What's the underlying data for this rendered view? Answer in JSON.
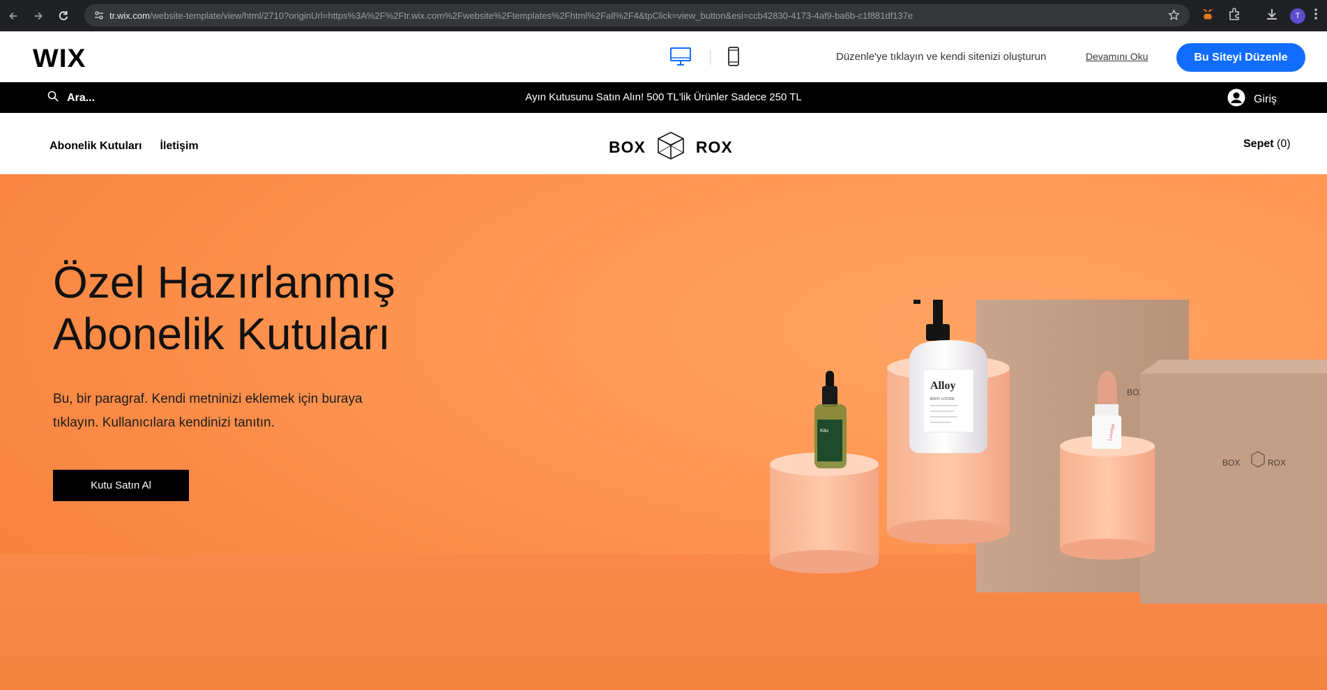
{
  "browser": {
    "url_host": "tr.wix.com",
    "url_rest": "/website-template/view/html/2710?originUrl=https%3A%2F%2Ftr.wix.com%2Fwebsite%2Ftemplates%2Fhtml%2Fall%2F4&tpClick=view_button&esi=ccb42830-4173-4af9-ba6b-c1f881df137e",
    "profile_initial": "T"
  },
  "wix_bar": {
    "logo": "WIX",
    "message": "Düzenle'ye tıklayın ve kendi sitenizi oluşturun",
    "read_more": "Devamını Oku",
    "edit_button": "Bu Siteyi Düzenle"
  },
  "announce": {
    "search_placeholder": "Ara...",
    "text": "Ayın Kutusunu Satın Alın! 500 TL'lik Ürünler Sadece 250 TL",
    "login": "Giriş"
  },
  "site_header": {
    "nav": [
      "Abonelik Kutuları",
      "İletişim"
    ],
    "brand_left": "BOX",
    "brand_right": "ROX",
    "cart_label": "Sepet",
    "cart_count": "(0)"
  },
  "hero": {
    "title_line1": "Özel Hazırlanmış",
    "title_line2": "Abonelik Kutuları",
    "paragraph": "Bu, bir paragraf. Kendi metninizi eklemek için buraya tıklayın. Kullanıcılara kendinizi tanıtın.",
    "button": "Kutu Satın Al"
  },
  "product_labels": {
    "lotion_brand": "Alloy",
    "lotion_type": "BODY LOTION",
    "serum_brand": "Kitu",
    "box_brand_left": "BOX",
    "box_brand_right": "ROX",
    "lipstick_brand": "Lovelipe"
  },
  "colors": {
    "accent_blue": "#116dff",
    "hero_orange": "#ff9552",
    "announce_bg": "#000000"
  }
}
